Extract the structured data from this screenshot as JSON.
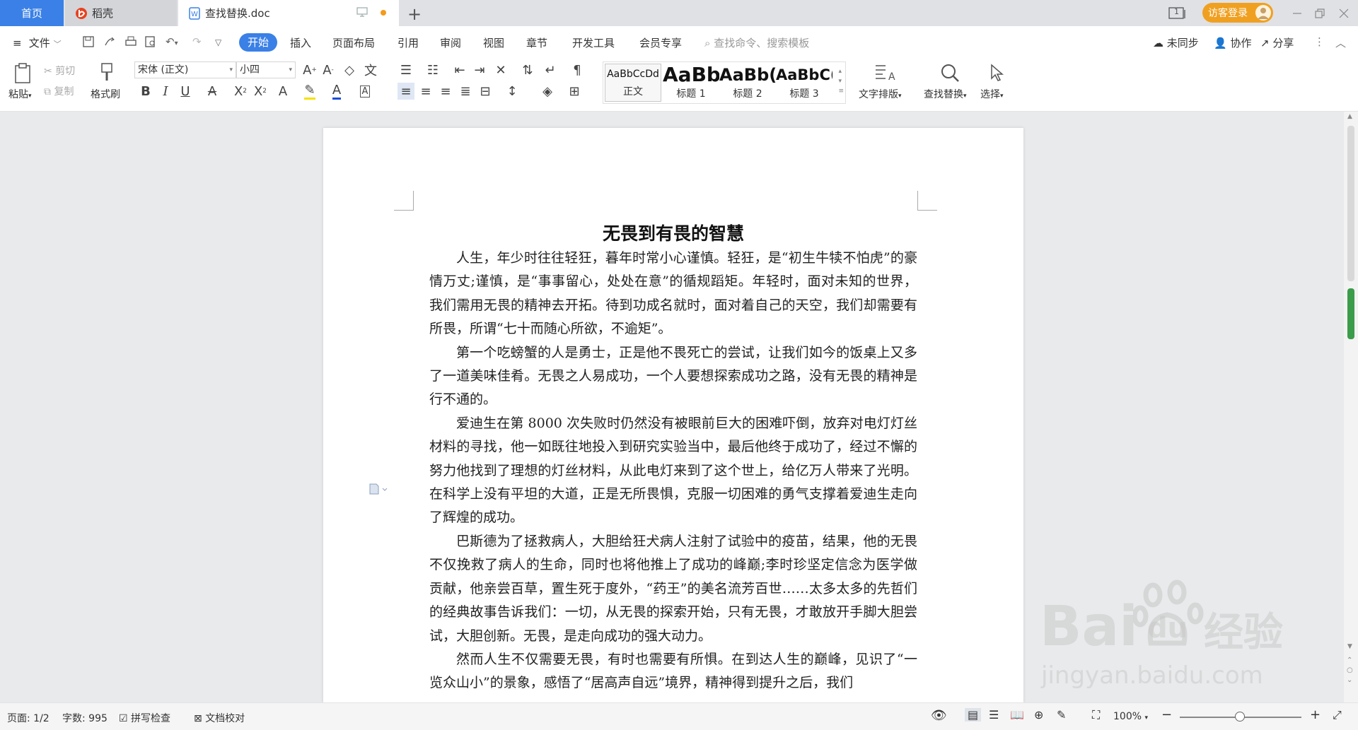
{
  "tabs": {
    "home": "首页",
    "daoke": "稻壳",
    "doc": "查找替换.doc"
  },
  "header": {
    "login": "访客登录",
    "page_indicator": "1"
  },
  "menu": {
    "file": "文件",
    "items": [
      "开始",
      "插入",
      "页面布局",
      "引用",
      "审阅",
      "视图",
      "章节",
      "开发工具",
      "会员专享"
    ],
    "search_placeholder": "查找命令、搜索模板",
    "sync": "未同步",
    "collab": "协作",
    "share": "分享"
  },
  "ribbon": {
    "paste": "粘贴",
    "cut": "剪切",
    "copy": "复制",
    "format_painter": "格式刷",
    "font_name": "宋体 (正文)",
    "font_size": "小四",
    "styles": [
      {
        "preview": "AaBbCcDd",
        "label": "正文"
      },
      {
        "preview": "AaBb",
        "label": "标题 1"
      },
      {
        "preview": "AaBb(",
        "label": "标题 2"
      },
      {
        "preview": "AaBbC(",
        "label": "标题 3"
      }
    ],
    "text_layout": "文字排版",
    "find_replace": "查找替换",
    "select": "选择"
  },
  "document": {
    "title": "无畏到有畏的智慧",
    "paragraphs": [
      "人生，年少时往往轻狂，暮年时常小心谨慎。轻狂，是“初生牛犊不怕虎”的豪情万丈;谨慎，是“事事留心，处处在意”的循规蹈矩。年轻时，面对未知的世界，我们需用无畏的精神去开拓。待到功成名就时，面对着自己的天空，我们却需要有所畏，所谓“七十而随心所欲，不逾矩”。",
      "第一个吃螃蟹的人是勇士，正是他不畏死亡的尝试，让我们如今的饭桌上又多了一道美味佳肴。无畏之人易成功，一个人要想探索成功之路，没有无畏的精神是行不通的。",
      "爱迪生在第 8000 次失败时仍然没有被眼前巨大的困难吓倒，放弃对电灯灯丝材料的寻找，他一如既往地投入到研究实验当中，最后他终于成功了，经过不懈的努力他找到了理想的灯丝材料，从此电灯来到了这个世上，给亿万人带来了光明。在科学上没有平坦的大道，正是无所畏惧，克服一切困难的勇气支撑着爱迪生走向了辉煌的成功。",
      "巴斯德为了拯救病人，大胆给狂犬病人注射了试验中的疫苗，结果，他的无畏不仅挽救了病人的生命，同时也将他推上了成功的峰巅;李时珍坚定信念为医学做贡献，他亲尝百草，置生死于度外，“药王”的美名流芳百世……太多太多的先哲们的经典故事告诉我们：一切，从无畏的探索开始，只有无畏，才敢放开手脚大胆尝试，大胆创新。无畏，是走向成功的强大动力。",
      "然而人生不仅需要无畏，有时也需要有所惧。在到达人生的巅峰，见识了“一览众山小”的景象，感悟了“居高声自远”境界，精神得到提升之后，我们"
    ]
  },
  "status": {
    "page": "页面: 1/2",
    "words": "字数: 995",
    "spell": "拼写检查",
    "proof": "文档校对",
    "zoom": "100%"
  },
  "watermark": {
    "brand": "Bai",
    "du": "du",
    "jingyan": "经验",
    "url": "jingyan.baidu.com"
  },
  "colors": {
    "accent": "#3a80e6",
    "login": "#f0a020",
    "scroll_thumb": "#3b9c4a"
  }
}
